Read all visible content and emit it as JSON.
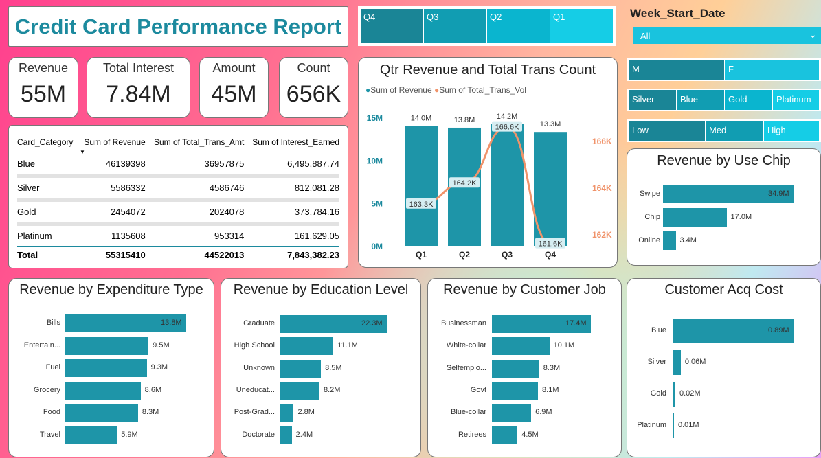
{
  "title": "Credit Card Performance Report",
  "kpis": [
    {
      "label": "Revenue",
      "value": "55M"
    },
    {
      "label": "Total Interest",
      "value": "7.84M"
    },
    {
      "label": "Amount",
      "value": "45M"
    },
    {
      "label": "Count",
      "value": "656K"
    }
  ],
  "quarter_slicer": [
    {
      "label": "Q4",
      "color": "#1a8596"
    },
    {
      "label": "Q3",
      "color": "#119db2"
    },
    {
      "label": "Q2",
      "color": "#0ab5cf"
    },
    {
      "label": "Q1",
      "color": "#15cde6"
    }
  ],
  "week_start": {
    "title": "Week_Start_Date",
    "value": "All"
  },
  "gender_slicer": [
    "M",
    "F"
  ],
  "category_slicer": [
    "Silver",
    "Blue",
    "Gold",
    "Platinum"
  ],
  "level_slicer": [
    "Low",
    "Med",
    "High"
  ],
  "table": {
    "headers": [
      "Card_Category",
      "Sum of Revenue",
      "Sum of Total_Trans_Amt",
      "Sum of Interest_Earned"
    ],
    "rows": [
      [
        "Blue",
        "46139398",
        "36957875",
        "6,495,887.74"
      ],
      [
        "Silver",
        "5586332",
        "4586746",
        "812,081.28"
      ],
      [
        "Gold",
        "2454072",
        "2024078",
        "373,784.16"
      ],
      [
        "Platinum",
        "1135608",
        "953314",
        "161,629.05"
      ]
    ],
    "total": [
      "Total",
      "55315410",
      "44522013",
      "7,843,382.23"
    ]
  },
  "chart_data": [
    {
      "type": "bar",
      "title": "Qtr Revenue and Total Trans Count",
      "categories": [
        "Q1",
        "Q2",
        "Q3",
        "Q4"
      ],
      "series": [
        {
          "name": "Sum of Revenue",
          "values": [
            14.0,
            13.8,
            14.2,
            13.3
          ],
          "labels": [
            "14.0M",
            "13.8M",
            "14.2M",
            "13.3M"
          ],
          "color": "#1e95a8"
        },
        {
          "name": "Sum of Total_Trans_Vol",
          "values": [
            163.3,
            164.2,
            166.6,
            161.6
          ],
          "labels": [
            "163.3K",
            "164.2K",
            "166.6K",
            "161.6K"
          ],
          "color": "#f0936a"
        }
      ],
      "left_ticks": [
        "15M",
        "10M",
        "5M",
        "0M"
      ],
      "right_ticks": [
        "166K",
        "164K",
        "162K"
      ],
      "ylim": [
        0,
        15
      ],
      "y2lim": [
        161.5,
        167
      ]
    },
    {
      "type": "bar",
      "title": "Revenue by Use Chip",
      "categories": [
        "Swipe",
        "Chip",
        "Online"
      ],
      "values": [
        34.9,
        17.0,
        3.4
      ],
      "labels": [
        "34.9M",
        "17.0M",
        "3.4M"
      ]
    },
    {
      "type": "bar",
      "title": "Revenue by Expenditure Type",
      "categories": [
        "Bills",
        "Entertain...",
        "Fuel",
        "Grocery",
        "Food",
        "Travel"
      ],
      "values": [
        13.8,
        9.5,
        9.3,
        8.6,
        8.3,
        5.9
      ],
      "labels": [
        "13.8M",
        "9.5M",
        "9.3M",
        "8.6M",
        "8.3M",
        "5.9M"
      ]
    },
    {
      "type": "bar",
      "title": "Revenue by Education Level",
      "categories": [
        "Graduate",
        "High School",
        "Unknown",
        "Uneducat...",
        "Post-Grad...",
        "Doctorate"
      ],
      "values": [
        22.3,
        11.1,
        8.5,
        8.2,
        2.8,
        2.4
      ],
      "labels": [
        "22.3M",
        "11.1M",
        "8.5M",
        "8.2M",
        "2.8M",
        "2.4M"
      ]
    },
    {
      "type": "bar",
      "title": "Revenue by Customer Job",
      "categories": [
        "Businessman",
        "White-collar",
        "Selfemplo...",
        "Govt",
        "Blue-collar",
        "Retirees"
      ],
      "values": [
        17.4,
        10.1,
        8.3,
        8.1,
        6.9,
        4.5
      ],
      "labels": [
        "17.4M",
        "10.1M",
        "8.3M",
        "8.1M",
        "6.9M",
        "4.5M"
      ]
    },
    {
      "type": "bar",
      "title": "Customer Acq Cost",
      "categories": [
        "Blue",
        "Silver",
        "Gold",
        "Platinum"
      ],
      "values": [
        0.89,
        0.06,
        0.02,
        0.01
      ],
      "labels": [
        "0.89M",
        "0.06M",
        "0.02M",
        "0.01M"
      ]
    }
  ],
  "colors": {
    "accent": "#1c8a9e",
    "bar": "#1e95a8",
    "line": "#f0936a",
    "slicer": "#19c3de"
  }
}
